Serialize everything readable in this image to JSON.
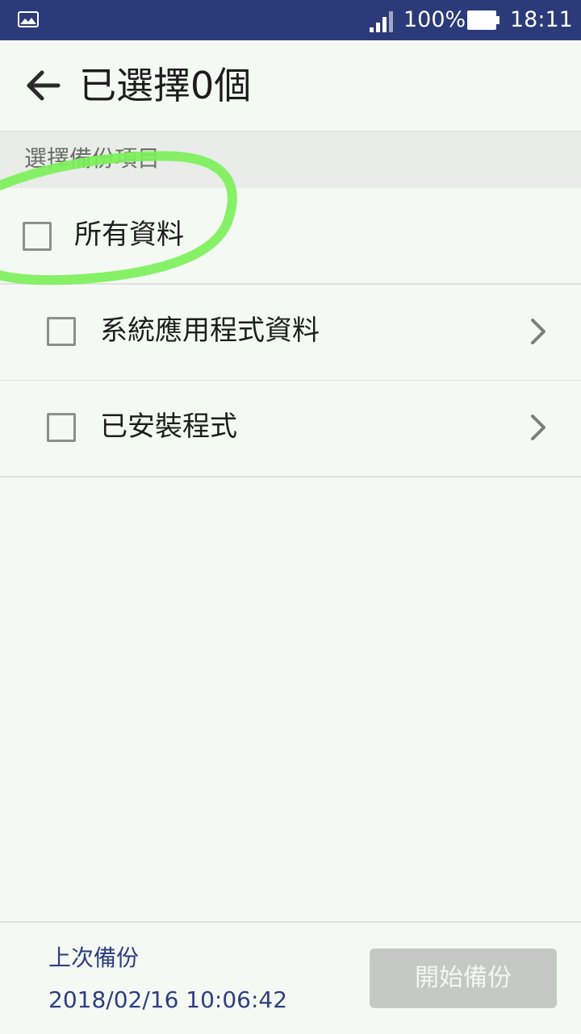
{
  "status_bar": {
    "notification_icon": "gallery-icon",
    "signal_icon": "signal-bars-icon",
    "battery_percent": "100%",
    "battery_icon": "battery-full-icon",
    "time": "18:11"
  },
  "app_bar": {
    "back_icon": "back-arrow-icon",
    "title": "已選擇0個"
  },
  "section": {
    "header": "選擇備份項目"
  },
  "items": [
    {
      "label": "所有資料",
      "checked": false,
      "has_chevron": false
    },
    {
      "label": "系統應用程式資料",
      "checked": false,
      "has_chevron": true
    },
    {
      "label": "已安裝程式",
      "checked": false,
      "has_chevron": true
    }
  ],
  "footer": {
    "last_backup_label": "上次備份",
    "last_backup_time": "2018/02/16 10:06:42",
    "start_button_label": "開始備份",
    "start_button_enabled": false
  },
  "colors": {
    "status_bar": "#2b3a78",
    "background": "#f4f8f3",
    "accent_text": "#2e3f7e",
    "disabled_button": "#c6c8c6",
    "annotation": "#7cf05a"
  }
}
